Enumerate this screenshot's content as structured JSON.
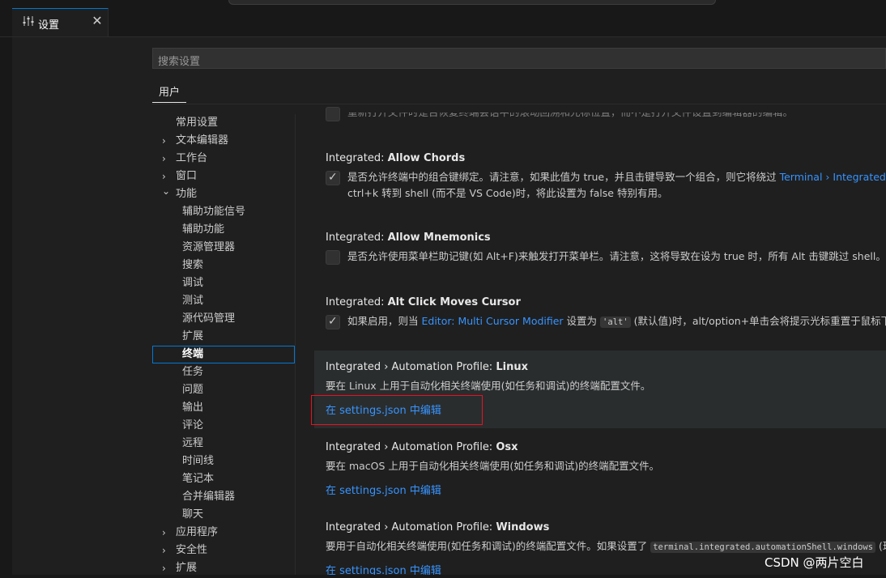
{
  "tab": {
    "title": "设置",
    "close": "✕"
  },
  "search": {
    "placeholder": "搜索设置"
  },
  "scope": {
    "user": "用户"
  },
  "toc": [
    {
      "label": "常用设置",
      "chevron": "",
      "level": 0
    },
    {
      "label": "文本编辑器",
      "chevron": "›",
      "level": 0
    },
    {
      "label": "工作台",
      "chevron": "›",
      "level": 0
    },
    {
      "label": "窗口",
      "chevron": "›",
      "level": 0
    },
    {
      "label": "功能",
      "chevron": "⌄",
      "level": 0
    },
    {
      "label": "辅助功能信号",
      "chevron": "",
      "level": 1
    },
    {
      "label": "辅助功能",
      "chevron": "",
      "level": 1
    },
    {
      "label": "资源管理器",
      "chevron": "",
      "level": 1
    },
    {
      "label": "搜索",
      "chevron": "",
      "level": 1
    },
    {
      "label": "调试",
      "chevron": "",
      "level": 1
    },
    {
      "label": "测试",
      "chevron": "",
      "level": 1
    },
    {
      "label": "源代码管理",
      "chevron": "",
      "level": 1
    },
    {
      "label": "扩展",
      "chevron": "",
      "level": 1
    },
    {
      "label": "终端",
      "chevron": "",
      "level": 1,
      "selected": true
    },
    {
      "label": "任务",
      "chevron": "",
      "level": 1
    },
    {
      "label": "问题",
      "chevron": "",
      "level": 1
    },
    {
      "label": "输出",
      "chevron": "",
      "level": 1
    },
    {
      "label": "评论",
      "chevron": "",
      "level": 1
    },
    {
      "label": "远程",
      "chevron": "",
      "level": 1
    },
    {
      "label": "时间线",
      "chevron": "",
      "level": 1
    },
    {
      "label": "笔记本",
      "chevron": "",
      "level": 1
    },
    {
      "label": "合并编辑器",
      "chevron": "",
      "level": 1
    },
    {
      "label": "聊天",
      "chevron": "",
      "level": 1
    },
    {
      "label": "应用程序",
      "chevron": "›",
      "level": 0
    },
    {
      "label": "安全性",
      "chevron": "›",
      "level": 0
    },
    {
      "label": "扩展",
      "chevron": "›",
      "level": 0
    }
  ],
  "settings": {
    "truncated_top": {
      "checked": false,
      "description": "重新打开文件时是否恢复终端会话中的滚动回溯和光标位置，而不是打开文件设置到编辑器的编辑。"
    },
    "allow_chords": {
      "prefix": "Integrated: ",
      "name": "Allow Chords",
      "checked": true,
      "desc_line1_a": "是否允许终端中的组合键绑定。请注意，如果此值为 true，并且击键导致一个组合，则它将绕过 ",
      "desc_line1_link": "Terminal › Integrated",
      "desc_line2": "ctrl+k 转到 shell (而不是 VS Code)时，将此设置为 false 特别有用。"
    },
    "allow_mnemonics": {
      "prefix": "Integrated: ",
      "name": "Allow Mnemonics",
      "checked": false,
      "description": "是否允许使用菜单栏助记键(如 Alt+F)来触发打开菜单栏。请注意，这将导致在设为 true 时，所有 Alt 击键跳过 shell。"
    },
    "alt_click": {
      "prefix": "Integrated: ",
      "name": "Alt Click Moves Cursor",
      "checked": true,
      "desc_a": "如果启用，则当 ",
      "desc_link": "Editor: Multi Cursor Modifier",
      "desc_b": " 设置为 ",
      "desc_code": "'alt'",
      "desc_c": " (默认值)时，alt/option+单击会将提示光标重置于鼠标下"
    },
    "profile_linux": {
      "prefix": "Integrated › Automation Profile: ",
      "name": "Linux",
      "description": "要在 Linux 上用于自动化相关终端使用(如任务和调试)的终端配置文件。",
      "edit": "在 settings.json 中编辑"
    },
    "profile_osx": {
      "prefix": "Integrated › Automation Profile: ",
      "name": "Osx",
      "description": "要在 macOS 上用于自动化相关终端使用(如任务和调试)的终端配置文件。",
      "edit": "在 settings.json 中编辑"
    },
    "profile_windows": {
      "prefix": "Integrated › Automation Profile: ",
      "name": "Windows",
      "desc_a": "要用于自动化相关终端使用(如任务和调试)的终端配置文件。如果设置了 ",
      "desc_code": "terminal.integrated.automationShell.windows",
      "desc_b": " (现",
      "edit": "在 settings.json 中编辑"
    }
  },
  "watermark": "CSDN @两片空白",
  "icons": {
    "settings_tab": "sliders-icon",
    "check": "✓"
  }
}
